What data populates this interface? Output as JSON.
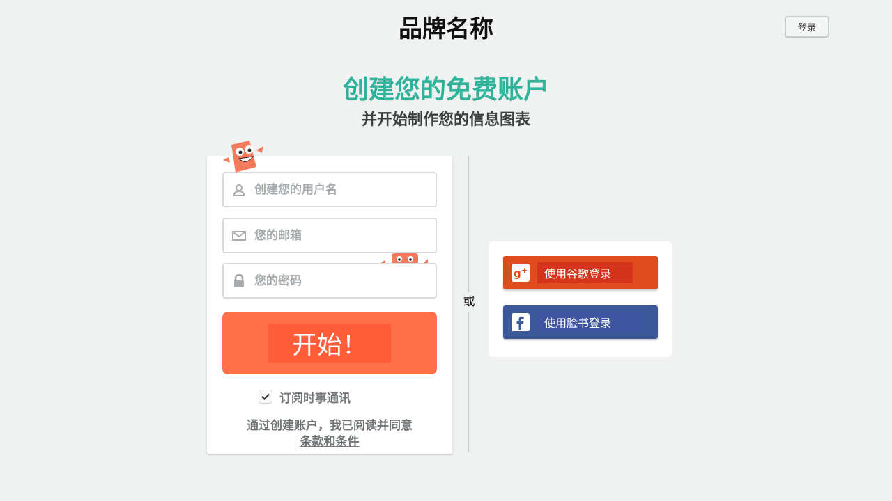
{
  "header": {
    "brand": "品牌名称",
    "login_label": "登录"
  },
  "hero": {
    "title": "创建您的免费账户",
    "subtitle": "并开始制作您的信息图表"
  },
  "form": {
    "username_placeholder": "创建您的用户名",
    "email_placeholder": "您的邮箱",
    "password_placeholder": "您的密码",
    "submit_label": "开始！",
    "newsletter_label": "订阅时事通讯",
    "newsletter_checked": true,
    "terms_text": "通过创建账户，我已阅读并同意",
    "terms_link": "条款和条件"
  },
  "divider": {
    "or_label": "或"
  },
  "social": {
    "google_label": "使用谷歌登录",
    "facebook_label": "使用脸书登录"
  },
  "colors": {
    "accent": "#2fb39a",
    "button": "#ff7049",
    "google": "#dd4b1e",
    "facebook": "#3b5998"
  },
  "icons": [
    "user-icon",
    "mail-icon",
    "lock-icon",
    "check-icon",
    "google-plus-icon",
    "facebook-icon",
    "mascot-icon"
  ]
}
